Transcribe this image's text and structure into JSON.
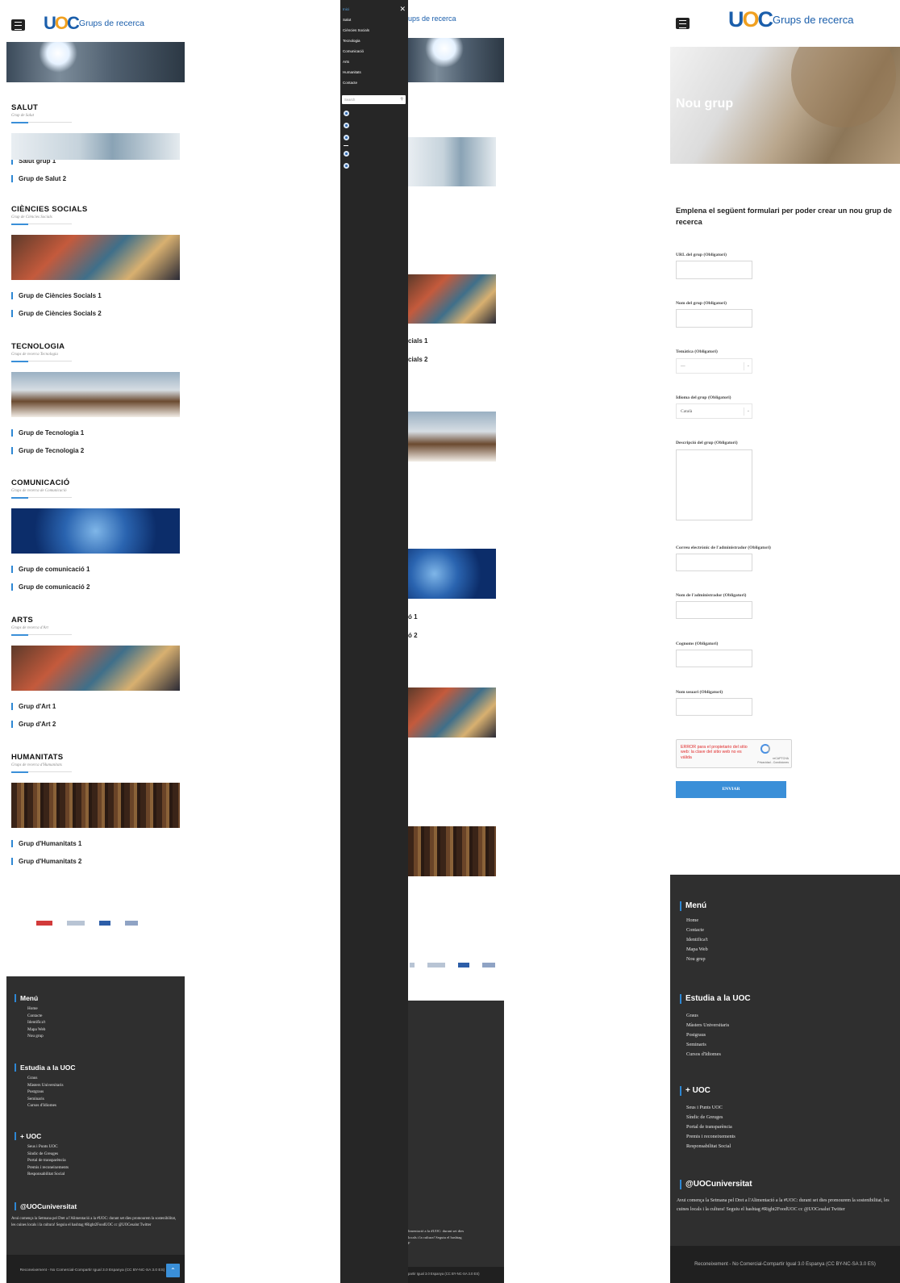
{
  "site": {
    "logo_text": "UOC",
    "site_title": "Grups de recerca"
  },
  "sections": [
    {
      "title": "SALUT",
      "subtitle": "Grup de Salut",
      "groups": [
        "Salut grup 1",
        "Grup de Salut 2"
      ]
    },
    {
      "title": "CIÈNCIES SOCIALS",
      "subtitle": "Grup de Ciències Socials",
      "groups": [
        "Grup de Ciències Socials 1",
        "Grup de Ciències Socials 2"
      ]
    },
    {
      "title": "TECNOLOGIA",
      "subtitle": "Grups de recerca Tecnologia",
      "groups": [
        "Grup de Tecnologia 1",
        "Grup de Tecnologia 2"
      ]
    },
    {
      "title": "COMUNICACIÓ",
      "subtitle": "Grups de recerca de Comunicació",
      "groups": [
        "Grup de comunicació 1",
        "Grup de comunicació 2"
      ]
    },
    {
      "title": "ARTS",
      "subtitle": "Grups de recerca d'Art",
      "groups": [
        "Grup d'Art 1",
        "Grup d'Art 2"
      ]
    },
    {
      "title": "HUMANITATS",
      "subtitle": "Grups de recerca d'Humanitats",
      "groups": [
        "Grup d'Humanitats 1",
        "Grup d'Humanitats 2"
      ]
    }
  ],
  "menu": {
    "items": [
      "Inici",
      "Salut",
      "Ciències Socials",
      "Tecnologia",
      "Comunicació",
      "Arts",
      "Humanitats",
      "Contacte"
    ],
    "search_placeholder": "Search",
    "close": "✕"
  },
  "new_group": {
    "banner_title": "Nou grup",
    "intro": "Emplena el següent formulari per poder crear un nou grup de recerca",
    "fields": {
      "url": "URL del grup (Obligatori)",
      "name": "Nom del grup (Obligatori)",
      "topic": "Temàtica (Obligatori)",
      "topic_value": "—",
      "language": "Idioma del grup (Obligatori)",
      "language_value": "Català",
      "description": "Descripció del grup (Obligatori)",
      "admin_email": "Correu electrònic de l'administrador (Obligatori)",
      "admin_name": "Nom de l'administrador (Obligatori)",
      "surnames": "Cognoms (Obligatori)",
      "username": "Nom usuari (Obligatori)"
    },
    "recaptcha_error": "ERROR para el propietario del sitio web: la clave del sitio web no es válida",
    "recaptcha_label": "reCAPTCHA",
    "recaptcha_links": "Privacidad - Condiciones",
    "submit": "ENVIAR"
  },
  "footer": {
    "menu_title": "Menú",
    "menu_links": [
      "Home",
      "Contacte",
      "Identifica't",
      "Mapa Web",
      "Nou grup"
    ],
    "study_title": "Estudia a la UOC",
    "study_links": [
      "Graus",
      "Màsters Universitaris",
      "Postgraus",
      "Seminaris",
      "Cursos d'Idiomes"
    ],
    "plus_title": "+ UOC",
    "plus_links": [
      "Seus i Punts UOC",
      "Síndic de Greuges",
      "Portal de transparència",
      "Premis i reconeixements",
      "Responsabilitat Social"
    ],
    "twitter_title": "@UOCuniversitat",
    "tweet": "Avui comença la Setmana pel Dret a l'Alimentació a la #UOC: durant set dies promourem la sostenibilitat, les cuines locals i la cultura! Seguiu el hashtag #Right2FoodUOC cc @UOCesalut Twitter",
    "license": "Reconeixement - No Comercial-Compartir Igual 3.0 Espanya (CC BY-NC-SA 3.0 ES)"
  },
  "icons": {
    "scroll_top": "chevron-up-icon",
    "menu": "hamburger-icon",
    "search": "search-icon",
    "close": "close-icon"
  },
  "colors": {
    "accent": "#2d87d4",
    "footer_bg": "#2f2f2f",
    "menu_bg": "#262626",
    "brand": "#1a5eab",
    "error": "#e02a2a"
  }
}
